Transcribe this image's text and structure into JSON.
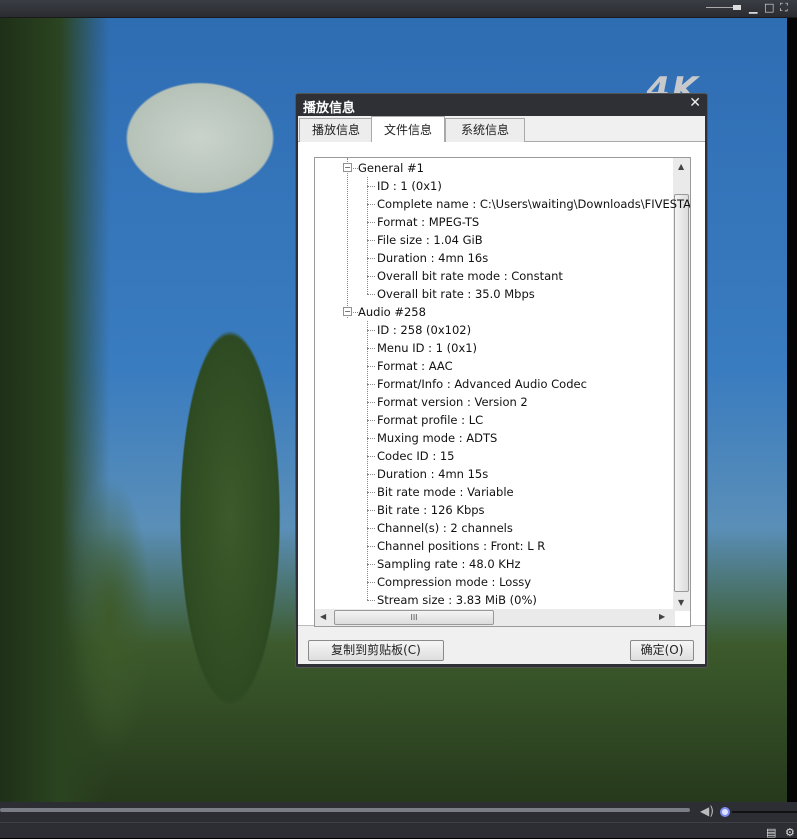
{
  "player": {
    "badge": "4K",
    "window_controls": [
      "minimize",
      "maximize",
      "fullscreen"
    ]
  },
  "dialog": {
    "title": "播放信息",
    "tabs": [
      {
        "label": "播放信息"
      },
      {
        "label": "文件信息",
        "active": true
      },
      {
        "label": "系统信息"
      }
    ],
    "tree": [
      {
        "label": "General #1",
        "children": [
          "ID : 1 (0x1)",
          "Complete name : C:\\Users\\waiting\\Downloads\\FIVESTA",
          "Format : MPEG-TS",
          "File size : 1.04 GiB",
          "Duration : 4mn 16s",
          "Overall bit rate mode : Constant",
          "Overall bit rate : 35.0 Mbps"
        ]
      },
      {
        "label": "Audio #258",
        "children": [
          "ID : 258 (0x102)",
          "Menu ID : 1 (0x1)",
          "Format : AAC",
          "Format/Info : Advanced Audio Codec",
          "Format version : Version 2",
          "Format profile : LC",
          "Muxing mode : ADTS",
          "Codec ID : 15",
          "Duration : 4mn 15s",
          "Bit rate mode : Variable",
          "Bit rate : 126 Kbps",
          "Channel(s) : 2 channels",
          "Channel positions : Front: L R",
          "Sampling rate : 48.0 KHz",
          "Compression mode : Lossy",
          "Stream size : 3.83 MiB (0%)"
        ]
      }
    ],
    "copy_button": "复制到剪贴板(C)",
    "ok_button": "确定(O)"
  }
}
